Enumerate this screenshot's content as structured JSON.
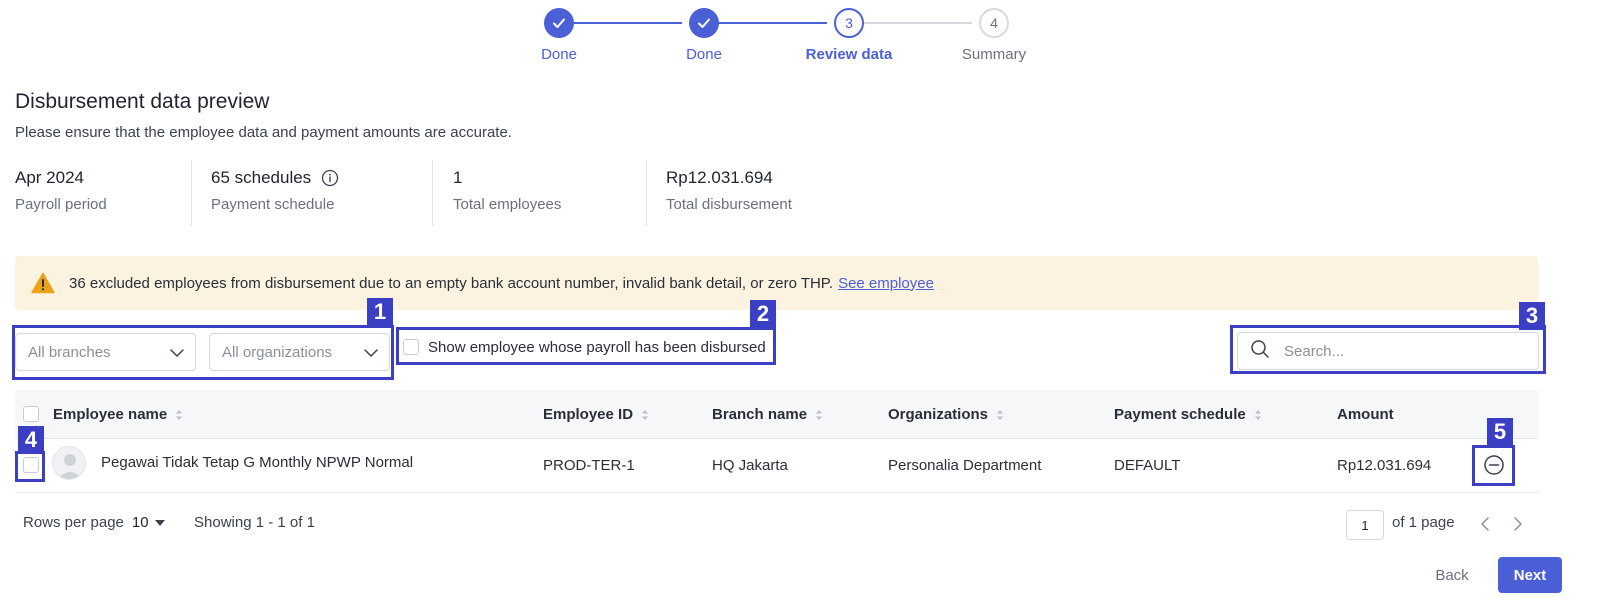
{
  "stepper": {
    "steps": [
      {
        "number": "1",
        "label": "Done",
        "state": "done"
      },
      {
        "number": "2",
        "label": "Done",
        "state": "done"
      },
      {
        "number": "3",
        "label": "Review data",
        "state": "current"
      },
      {
        "number": "4",
        "label": "Summary",
        "state": "todo"
      }
    ]
  },
  "header": {
    "title": "Disbursement data preview",
    "subtitle": "Please ensure that the employee data and payment amounts are accurate."
  },
  "stats": [
    {
      "value": "Apr 2024",
      "caption": "Payroll period"
    },
    {
      "value": "65 schedules",
      "caption": "Payment schedule"
    },
    {
      "value": "1",
      "caption": "Total employees"
    },
    {
      "value": "Rp12.031.694",
      "caption": "Total disbursement"
    }
  ],
  "alert": {
    "text": "36 excluded employees from disbursement due to an empty bank account number, invalid bank detail, or zero THP.",
    "link": "See employee"
  },
  "filters": {
    "branches": "All branches",
    "organizations": "All organizations",
    "show_disbursed_label": "Show employee whose payroll has been disbursed",
    "search_placeholder": "Search..."
  },
  "annotations": [
    "1",
    "2",
    "3",
    "4",
    "5"
  ],
  "table": {
    "columns": [
      "Employee name",
      "Employee ID",
      "Branch name",
      "Organizations",
      "Payment schedule",
      "Amount"
    ],
    "rows": [
      {
        "name": "Pegawai Tidak Tetap G Monthly NPWP Normal",
        "employee_id": "PROD-TER-1",
        "branch": "HQ Jakarta",
        "organization": "Personalia Department",
        "schedule": "DEFAULT",
        "amount": "Rp12.031.694"
      }
    ]
  },
  "pagination": {
    "rows_per_page_label": "Rows per page",
    "rows_per_page_value": "10",
    "showing": "Showing 1 - 1 of 1",
    "current_page": "1",
    "total_pages": "of 1 page"
  },
  "footer": {
    "back": "Back",
    "next": "Next"
  },
  "colors": {
    "accent": "#4b5fd6",
    "annotation": "#3b3fc4",
    "alert_bg": "#fbf3e0",
    "warning": "#e8a317"
  }
}
